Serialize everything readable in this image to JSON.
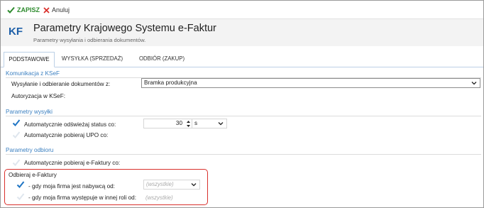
{
  "toolbar": {
    "save_label": "ZAPISZ",
    "cancel_label": "Anuluj"
  },
  "header": {
    "logo": "KF",
    "title": "Parametry Krajowego Systemu e-Faktur",
    "subtitle": "Parametry wysyłania i odbierania dokumentów."
  },
  "tabs": [
    {
      "label": "PODSTAWOWE",
      "active": true
    },
    {
      "label": "WYSYŁKA (SPRZEDAŻ)",
      "active": false
    },
    {
      "label": "ODBIÓR (ZAKUP)",
      "active": false
    }
  ],
  "sections": {
    "ksef": {
      "title": "Komunikacja z KSeF",
      "send_receive_label": "Wysyłanie i odbieranie dokumentów z:",
      "send_receive_value": "Bramka produkcyjna",
      "auth_label": "Autoryzacja w KSeF:"
    },
    "send": {
      "title": "Parametry wysyłki",
      "auto_refresh_label": "Automatycznie odświeżaj status co:",
      "auto_refresh_checked": true,
      "auto_refresh_value": "30",
      "auto_refresh_unit": "s",
      "auto_upo_label": "Automatycznie pobieraj UPO co:",
      "auto_upo_checked": false
    },
    "receive": {
      "title": "Parametry odbioru",
      "auto_fetch_label": "Automatycznie pobieraj e-Faktury co:",
      "auto_fetch_checked": false,
      "group_title": "Odbieraj e-Faktury",
      "buyer_label": "- gdy moja firma jest nabywcą od:",
      "buyer_checked": true,
      "buyer_value": "(wszystkie)",
      "other_role_label": "- gdy moja firma występuje w innej roli od:",
      "other_role_checked": false,
      "other_role_value": "(wszystkie)"
    }
  },
  "colors": {
    "accent": "#3a7fc0",
    "check": "#1f75c4",
    "highlight": "#d9302c",
    "save": "#2e8b2e"
  }
}
